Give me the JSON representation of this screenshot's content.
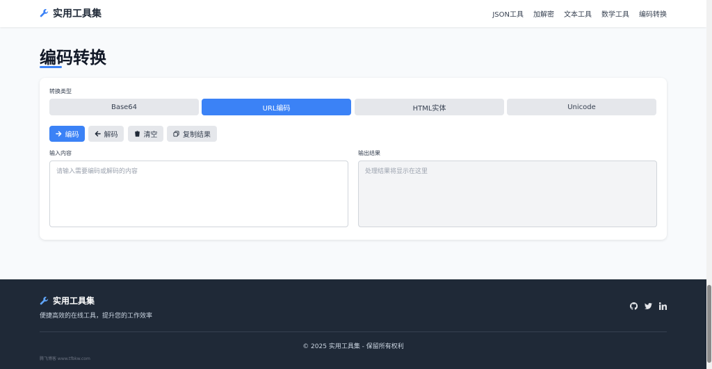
{
  "header": {
    "brand": "实用工具集",
    "nav": [
      "JSON工具",
      "加解密",
      "文本工具",
      "数学工具",
      "编码转换"
    ]
  },
  "page": {
    "title": "编码转换"
  },
  "converter": {
    "type_label": "转换类型",
    "types": [
      "Base64",
      "URL编码",
      "HTML实体",
      "Unicode"
    ],
    "active_type": "URL编码",
    "actions": {
      "encode": "编码",
      "decode": "解码",
      "clear": "清空",
      "copy": "复制结果"
    },
    "input": {
      "label": "输入内容",
      "placeholder": "请输入需要编码或解码的内容",
      "value": ""
    },
    "output": {
      "label": "输出结果",
      "placeholder": "处理结果将显示在这里",
      "value": ""
    }
  },
  "footer": {
    "brand": "实用工具集",
    "tagline": "便捷高效的在线工具，提升您的工作效率",
    "copyright": "© 2025 实用工具集 - 保留所有权利",
    "watermark": "腾飞博客 www.tfbkw.com",
    "social": [
      "github-icon",
      "twitter-icon",
      "linkedin-icon"
    ]
  },
  "colors": {
    "accent": "#3b82f6",
    "footer_bg": "#1f2937",
    "page_bg": "#f8fafc"
  }
}
